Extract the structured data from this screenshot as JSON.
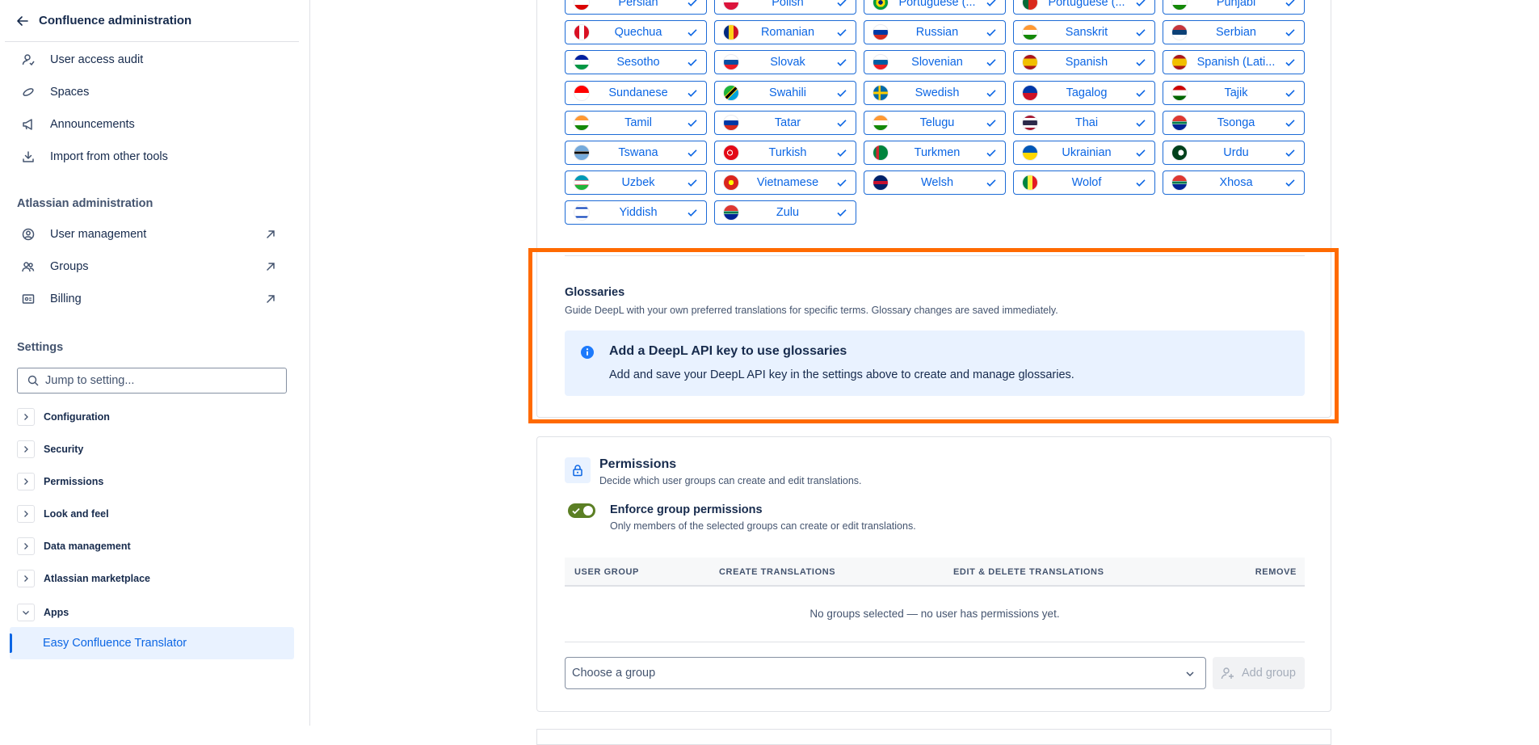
{
  "sidebar": {
    "header_title": "Confluence administration",
    "top_items": [
      {
        "label": "User access audit",
        "icon": "user-audit-icon"
      },
      {
        "label": "Spaces",
        "icon": "spaces-icon"
      },
      {
        "label": "Announcements",
        "icon": "megaphone-icon"
      },
      {
        "label": "Import from other tools",
        "icon": "download-icon"
      }
    ],
    "atlassian_section": "Atlassian administration",
    "atlassian_items": [
      {
        "label": "User management",
        "icon": "user-circle-icon"
      },
      {
        "label": "Groups",
        "icon": "people-icon"
      },
      {
        "label": "Billing",
        "icon": "billing-icon"
      }
    ],
    "settings_section": "Settings",
    "search_placeholder": "Jump to setting...",
    "categories": [
      "Configuration",
      "Security",
      "Permissions",
      "Look and feel",
      "Data management",
      "Atlassian marketplace",
      "Apps"
    ],
    "active_item": "Easy Confluence Translator"
  },
  "languages": [
    {
      "name": "Persian",
      "flag": "ir"
    },
    {
      "name": "Polish",
      "flag": "pl"
    },
    {
      "name": "Portuguese (...",
      "flag": "br"
    },
    {
      "name": "Portuguese (...",
      "flag": "pt"
    },
    {
      "name": "Punjabi",
      "flag": "in"
    },
    {
      "name": "Quechua",
      "flag": "pe"
    },
    {
      "name": "Romanian",
      "flag": "ro"
    },
    {
      "name": "Russian",
      "flag": "ru"
    },
    {
      "name": "Sanskrit",
      "flag": "in"
    },
    {
      "name": "Serbian",
      "flag": "rs"
    },
    {
      "name": "Sesotho",
      "flag": "ls"
    },
    {
      "name": "Slovak",
      "flag": "sk"
    },
    {
      "name": "Slovenian",
      "flag": "si"
    },
    {
      "name": "Spanish",
      "flag": "es"
    },
    {
      "name": "Spanish (Lati...",
      "flag": "es"
    },
    {
      "name": "Sundanese",
      "flag": "id"
    },
    {
      "name": "Swahili",
      "flag": "tz"
    },
    {
      "name": "Swedish",
      "flag": "se"
    },
    {
      "name": "Tagalog",
      "flag": "ph"
    },
    {
      "name": "Tajik",
      "flag": "tj"
    },
    {
      "name": "Tamil",
      "flag": "in"
    },
    {
      "name": "Tatar",
      "flag": "ru"
    },
    {
      "name": "Telugu",
      "flag": "in"
    },
    {
      "name": "Thai",
      "flag": "th"
    },
    {
      "name": "Tsonga",
      "flag": "za"
    },
    {
      "name": "Tswana",
      "flag": "bw"
    },
    {
      "name": "Turkish",
      "flag": "tr"
    },
    {
      "name": "Turkmen",
      "flag": "tm"
    },
    {
      "name": "Ukrainian",
      "flag": "ua"
    },
    {
      "name": "Urdu",
      "flag": "pk"
    },
    {
      "name": "Uzbek",
      "flag": "uz"
    },
    {
      "name": "Vietnamese",
      "flag": "vn"
    },
    {
      "name": "Welsh",
      "flag": "gb"
    },
    {
      "name": "Wolof",
      "flag": "sn"
    },
    {
      "name": "Xhosa",
      "flag": "za"
    },
    {
      "name": "Yiddish",
      "flag": "il"
    },
    {
      "name": "Zulu",
      "flag": "za"
    }
  ],
  "glossaries": {
    "title": "Glossaries",
    "description": "Guide DeepL with your own preferred translations for specific terms. Glossary changes are saved immediately.",
    "info_title": "Add a DeepL API key to use glossaries",
    "info_body": "Add and save your DeepL API key in the settings above to create and manage glossaries."
  },
  "permissions": {
    "title": "Permissions",
    "description": "Decide which user groups can create and edit translations.",
    "toggle_title": "Enforce group permissions",
    "toggle_desc": "Only members of the selected groups can create or edit translations.",
    "toggle_on": true,
    "columns": [
      "USER GROUP",
      "CREATE TRANSLATIONS",
      "EDIT & DELETE TRANSLATIONS",
      "REMOVE"
    ],
    "empty_text": "No groups selected — no user has permissions yet.",
    "select_placeholder": "Choose a group",
    "add_button": "Add group"
  },
  "colors": {
    "accent": "#0c66e4",
    "highlight": "#ff6a00",
    "toggle_on": "#5b7f24",
    "info_bg": "#e9f2ff"
  }
}
